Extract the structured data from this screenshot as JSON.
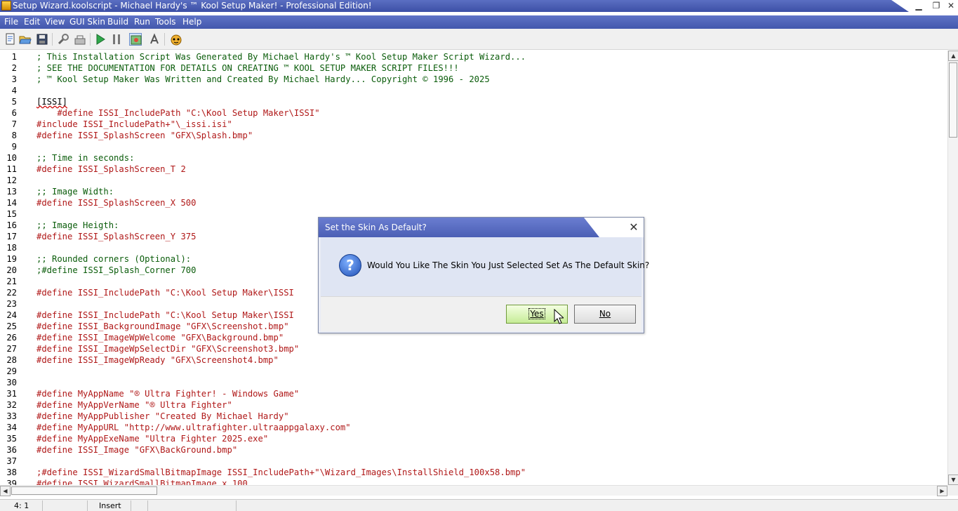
{
  "window": {
    "title": "Setup Wizard.koolscript - Michael Hardy's ™ Kool Setup Maker! - Professional Edition!",
    "controls": {
      "minimize": "▁",
      "restore": "❐",
      "close": "✕"
    }
  },
  "menu": [
    "File",
    "Edit",
    "View",
    "GUI Skin",
    "Build",
    "Run",
    "Tools",
    "Help"
  ],
  "toolbar": {
    "icons": [
      "new-script-icon",
      "open-icon",
      "save-icon",
      "wrench-icon",
      "build-icon",
      "run-icon",
      "pause-icon",
      "skin-icon",
      "test-icon",
      "mascot-icon"
    ]
  },
  "editor": {
    "lines": [
      {
        "n": "1",
        "text": "; This Installation Script Was Generated By Michael Hardy's ™ Kool Setup Maker Script Wizard...",
        "kind": "comment"
      },
      {
        "n": "2",
        "text": "; SEE THE DOCUMENTATION FOR DETAILS ON CREATING ™ KOOL SETUP MAKER SCRIPT FILES!!!",
        "kind": "comment"
      },
      {
        "n": "3",
        "text": "; ™ Kool Setup Maker Was Written and Created By Michael Hardy... Copyright © 1996 - 2025",
        "kind": "comment"
      },
      {
        "n": "4",
        "text": "",
        "kind": "plain"
      },
      {
        "n": "5",
        "text": "[ISSI]",
        "kind": "section"
      },
      {
        "n": "6",
        "text": "    #define ISSI_IncludePath \"C:\\Kool Setup Maker\\ISSI\"",
        "kind": "define"
      },
      {
        "n": "7",
        "text": "#include ISSI_IncludePath+\"\\_issi.isi\"",
        "kind": "define"
      },
      {
        "n": "8",
        "text": "#define ISSI_SplashScreen \"GFX\\Splash.bmp\"",
        "kind": "define"
      },
      {
        "n": "9",
        "text": "",
        "kind": "plain"
      },
      {
        "n": "10",
        "text": ";; Time in seconds:",
        "kind": "comment"
      },
      {
        "n": "11",
        "text": "#define ISSI_SplashScreen_T 2",
        "kind": "define"
      },
      {
        "n": "12",
        "text": "",
        "kind": "plain"
      },
      {
        "n": "13",
        "text": ";; Image Width:",
        "kind": "comment"
      },
      {
        "n": "14",
        "text": "#define ISSI_SplashScreen_X 500",
        "kind": "define"
      },
      {
        "n": "15",
        "text": "",
        "kind": "plain"
      },
      {
        "n": "16",
        "text": ";; Image Heigth:",
        "kind": "comment"
      },
      {
        "n": "17",
        "text": "#define ISSI_SplashScreen_Y 375",
        "kind": "define"
      },
      {
        "n": "18",
        "text": "",
        "kind": "plain"
      },
      {
        "n": "19",
        "text": ";; Rounded corners (Optional):",
        "kind": "comment"
      },
      {
        "n": "20",
        "text": ";#define ISSI_Splash_Corner 700",
        "kind": "comment"
      },
      {
        "n": "21",
        "text": "",
        "kind": "plain"
      },
      {
        "n": "22",
        "text": "#define ISSI_IncludePath \"C:\\Kool Setup Maker\\ISSI",
        "kind": "define"
      },
      {
        "n": "23",
        "text": "",
        "kind": "plain"
      },
      {
        "n": "24",
        "text": "#define ISSI_IncludePath \"C:\\Kool Setup Maker\\ISSI",
        "kind": "define"
      },
      {
        "n": "25",
        "text": "#define ISSI_BackgroundImage \"GFX\\Screenshot.bmp\"",
        "kind": "define"
      },
      {
        "n": "26",
        "text": "#define ISSI_ImageWpWelcome \"GFX\\Background.bmp\"",
        "kind": "define"
      },
      {
        "n": "27",
        "text": "#define ISSI_ImageWpSelectDir \"GFX\\Screenshot3.bmp\"",
        "kind": "define"
      },
      {
        "n": "28",
        "text": "#define ISSI_ImageWpReady \"GFX\\Screenshot4.bmp\"",
        "kind": "define"
      },
      {
        "n": "29",
        "text": "",
        "kind": "plain"
      },
      {
        "n": "30",
        "text": "",
        "kind": "plain"
      },
      {
        "n": "31",
        "text": "#define MyAppName \"® Ultra Fighter! - Windows Game\"",
        "kind": "define"
      },
      {
        "n": "32",
        "text": "#define MyAppVerName \"® Ultra Fighter\"",
        "kind": "define"
      },
      {
        "n": "33",
        "text": "#define MyAppPublisher \"Created By Michael Hardy\"",
        "kind": "define"
      },
      {
        "n": "34",
        "text": "#define MyAppURL \"http://www.ultrafighter.ultraappgalaxy.com\"",
        "kind": "define"
      },
      {
        "n": "35",
        "text": "#define MyAppExeName \"Ultra Fighter 2025.exe\"",
        "kind": "define"
      },
      {
        "n": "36",
        "text": "#define ISSI_Image \"GFX\\BackGround.bmp\"",
        "kind": "define"
      },
      {
        "n": "37",
        "text": "",
        "kind": "plain"
      },
      {
        "n": "38",
        "text": ";#define ISSI_WizardSmallBitmapImage ISSI_IncludePath+\"\\Wizard_Images\\InstallShield_100x58.bmp\"",
        "kind": "define"
      },
      {
        "n": "39",
        "text": "#define ISSI_WizardSmallBitmapImage x 100",
        "kind": "define"
      }
    ]
  },
  "statusbar": {
    "position": "4:  1",
    "mode": "Insert"
  },
  "dialog": {
    "title": "Set the Skin As Default?",
    "close": "✕",
    "icon": "question-icon",
    "message": "Would You Like The Skin You Just Selected Set As The Default Skin?",
    "yes_label": "Yes",
    "no_label": "No"
  },
  "colors": {
    "title_band": "#4358ad",
    "comment": "#0a5c0a",
    "define": "#b01818",
    "yes_button": "#c6ec96"
  }
}
